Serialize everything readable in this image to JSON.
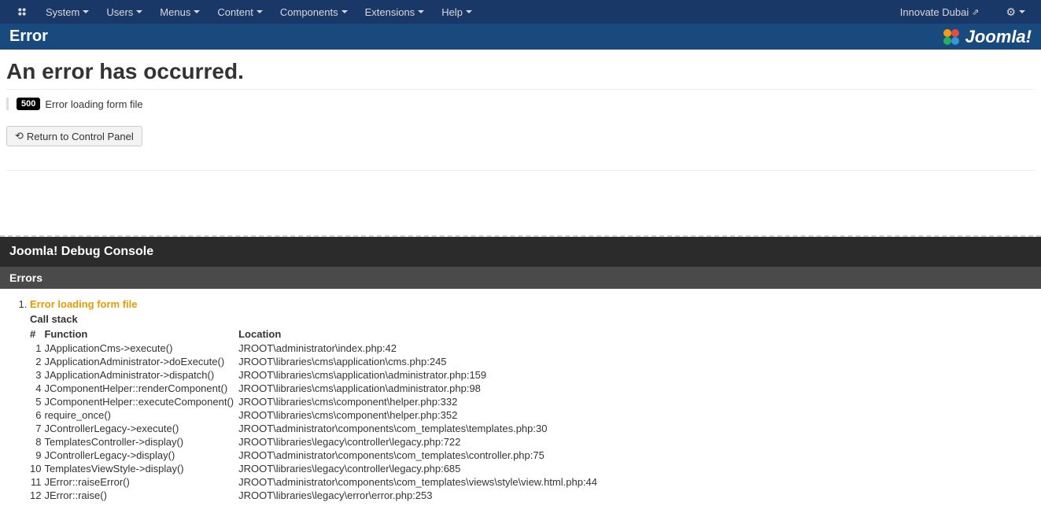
{
  "nav": {
    "items": [
      "System",
      "Users",
      "Menus",
      "Content",
      "Components",
      "Extensions",
      "Help"
    ],
    "site_name": "Innovate Dubai"
  },
  "header": {
    "title": "Error",
    "brand": "Joomla!"
  },
  "error": {
    "heading": "An error has occurred.",
    "code": "500",
    "message": "Error loading form file",
    "return_button": "Return to Control Panel"
  },
  "debug": {
    "console_title": "Joomla! Debug Console",
    "section_title": "Errors",
    "error_title": "Error loading form file",
    "callstack_label": "Call stack",
    "headers": {
      "num": "#",
      "func": "Function",
      "loc": "Location"
    },
    "stack": [
      {
        "n": "1",
        "func": "JApplicationCms->execute()",
        "loc": "JROOT\\administrator\\index.php:42"
      },
      {
        "n": "2",
        "func": "JApplicationAdministrator->doExecute()",
        "loc": "JROOT\\libraries\\cms\\application\\cms.php:245"
      },
      {
        "n": "3",
        "func": "JApplicationAdministrator->dispatch()",
        "loc": "JROOT\\libraries\\cms\\application\\administrator.php:159"
      },
      {
        "n": "4",
        "func": "JComponentHelper::renderComponent()",
        "loc": "JROOT\\libraries\\cms\\application\\administrator.php:98"
      },
      {
        "n": "5",
        "func": "JComponentHelper::executeComponent()",
        "loc": "JROOT\\libraries\\cms\\component\\helper.php:332"
      },
      {
        "n": "6",
        "func": "require_once()",
        "loc": "JROOT\\libraries\\cms\\component\\helper.php:352"
      },
      {
        "n": "7",
        "func": "JControllerLegacy->execute()",
        "loc": "JROOT\\administrator\\components\\com_templates\\templates.php:30"
      },
      {
        "n": "8",
        "func": "TemplatesController->display()",
        "loc": "JROOT\\libraries\\legacy\\controller\\legacy.php:722"
      },
      {
        "n": "9",
        "func": "JControllerLegacy->display()",
        "loc": "JROOT\\administrator\\components\\com_templates\\controller.php:75"
      },
      {
        "n": "10",
        "func": "TemplatesViewStyle->display()",
        "loc": "JROOT\\libraries\\legacy\\controller\\legacy.php:685"
      },
      {
        "n": "11",
        "func": "JError::raiseError()",
        "loc": "JROOT\\administrator\\components\\com_templates\\views\\style\\view.html.php:44"
      },
      {
        "n": "12",
        "func": "JError::raise()",
        "loc": "JROOT\\libraries\\legacy\\error\\error.php:253"
      }
    ]
  }
}
